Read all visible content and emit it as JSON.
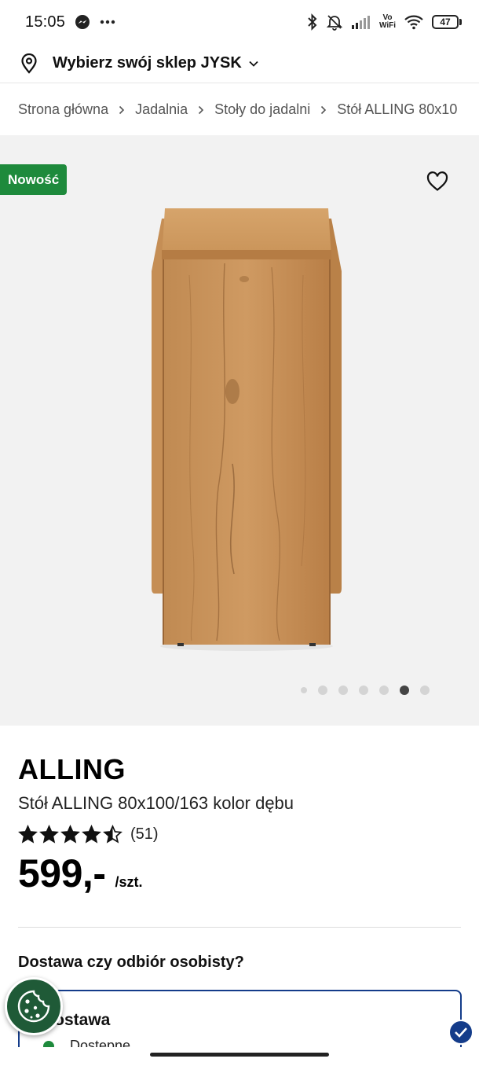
{
  "status_bar": {
    "time": "15:05",
    "left_icons": [
      "messenger-icon",
      "more-dots-icon"
    ],
    "right_icons": [
      "bluetooth-icon",
      "bell-off-icon",
      "signal-icon",
      "vowifi-icon",
      "wifi-icon",
      "battery-icon"
    ],
    "vowifi_top": "Vo",
    "vowifi_bottom": "WiFi",
    "battery_level": "47"
  },
  "store": {
    "label": "Wybierz swój sklep JYSK",
    "icon": "location-pin-icon"
  },
  "breadcrumb": {
    "items": [
      "Strona główna",
      "Jadalnia",
      "Stoły do jadalni",
      "Stół ALLING 80x10"
    ]
  },
  "gallery": {
    "badge": "Nowość",
    "favorite_icon": "heart-icon",
    "image_count": 7,
    "active_index": 5
  },
  "product": {
    "brand": "ALLING",
    "name": "Stół ALLING 80x100/163 kolor dębu",
    "rating": 4.5,
    "rating_max": 5,
    "reviews": "(51)",
    "price": "599,-",
    "unit": "/szt."
  },
  "delivery": {
    "heading": "Dostawa czy odbiór osobisty?",
    "option_title": "Dostawa",
    "availability": "Dostępne"
  },
  "colors": {
    "badge_green": "#1e8a3c",
    "card_border": "#143c8a",
    "cookie_green": "#1f5a37"
  }
}
